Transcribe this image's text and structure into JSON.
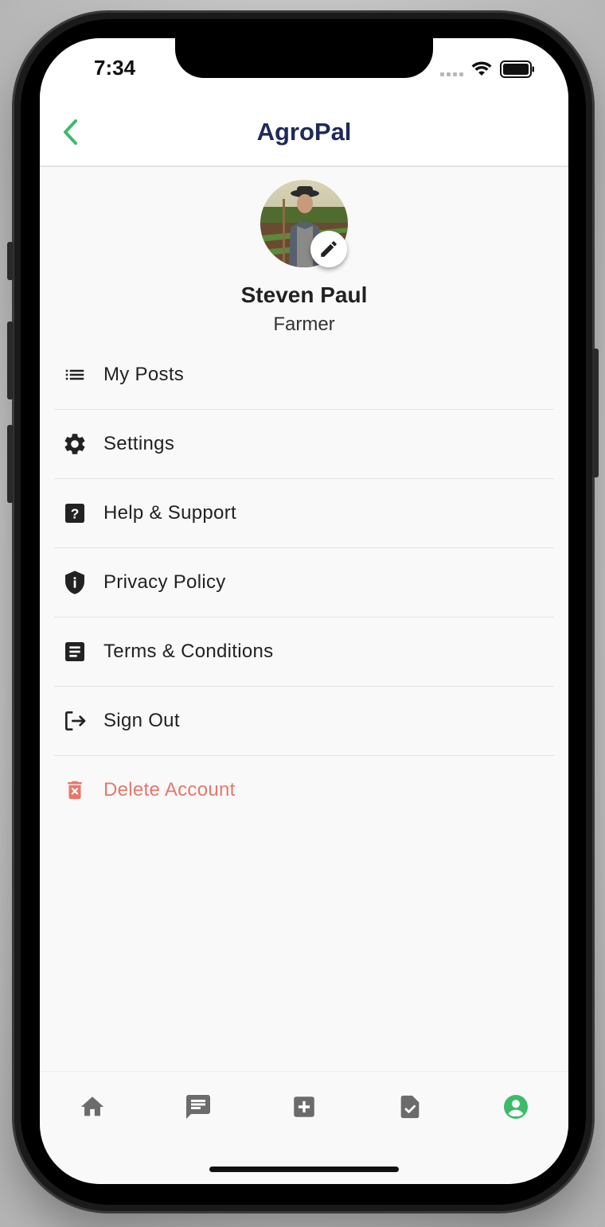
{
  "status_bar": {
    "time": "7:34"
  },
  "app_bar": {
    "title": "AgroPal"
  },
  "profile": {
    "name": "Steven Paul",
    "role": "Farmer"
  },
  "menu": {
    "items": [
      {
        "label": "My Posts",
        "icon": "list-icon"
      },
      {
        "label": "Settings",
        "icon": "gear-icon"
      },
      {
        "label": "Help & Support",
        "icon": "help-icon"
      },
      {
        "label": "Privacy Policy",
        "icon": "shield-icon"
      },
      {
        "label": "Terms & Conditions",
        "icon": "document-icon"
      },
      {
        "label": "Sign Out",
        "icon": "sign-out-icon"
      },
      {
        "label": "Delete Account",
        "icon": "delete-icon"
      }
    ]
  },
  "bottom_nav": {
    "items": [
      {
        "icon": "home-icon"
      },
      {
        "icon": "chat-icon"
      },
      {
        "icon": "add-icon"
      },
      {
        "icon": "task-icon"
      },
      {
        "icon": "profile-icon",
        "active": true
      }
    ]
  },
  "colors": {
    "accent": "#3dbb6a",
    "title": "#1f2a5a",
    "danger": "#e8776a",
    "icon": "#222222",
    "nav_inactive": "#6b6b6b"
  }
}
